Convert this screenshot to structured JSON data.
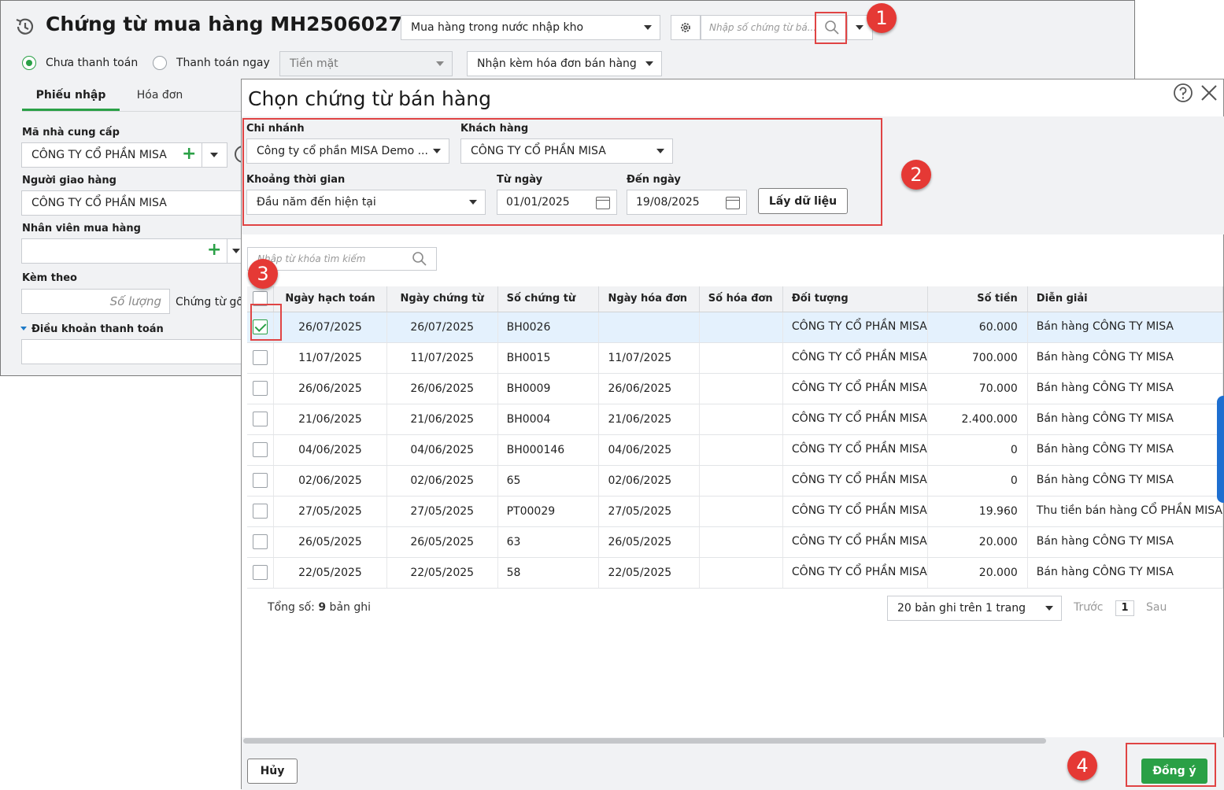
{
  "main_window": {
    "title": "Chứng từ mua hàng MH2506027",
    "purchase_type": "Mua hàng trong nước nhập kho",
    "search_placeholder": "Nhập số chứng từ bá...",
    "payment_unpaid_label": "Chưa thanh toán",
    "payment_now_label": "Thanh toán ngay",
    "payment_method": "Tiền mặt",
    "invoice_option": "Nhận kèm hóa đơn bán hàng",
    "tabs": [
      {
        "label": "Phiếu nhập"
      },
      {
        "label": "Hóa đơn"
      }
    ],
    "supplier_label": "Mã nhà cung cấp",
    "supplier_value": "CÔNG TY CỔ PHẦN MISA",
    "deliverer_label": "Người giao hàng",
    "deliverer_value": "CÔNG TY CỔ PHẦN MISA",
    "buyer_label": "Nhân viên mua hàng",
    "attach_label": "Kèm theo",
    "quantity_placeholder": "Số lượng",
    "original_docs_label": "Chứng từ gố",
    "payment_terms_label": "Điều khoản thanh toán"
  },
  "dialog": {
    "title": "Chọn chứng từ bán hàng",
    "branch_label": "Chi nhánh",
    "branch_value": "Công ty cổ phần MISA Demo ...",
    "customer_label": "Khách hàng",
    "customer_value": "CÔNG TY CỔ PHẦN MISA",
    "period_label": "Khoảng thời gian",
    "period_value": "Đầu năm đến hiện tại",
    "from_label": "Từ ngày",
    "from_value": "01/01/2025",
    "to_label": "Đến ngày",
    "to_value": "19/08/2025",
    "fetch_button": "Lấy dữ liệu",
    "keyword_placeholder": "Nhập từ khóa tìm kiếm",
    "columns": [
      "Ngày hạch toán",
      "Ngày chứng từ",
      "Số chứng từ",
      "Ngày hóa đơn",
      "Số hóa đơn",
      "Đối tượng",
      "Số tiền",
      "Diễn giải"
    ],
    "rows": [
      {
        "checked": true,
        "post_date": "26/07/2025",
        "doc_date": "26/07/2025",
        "doc_no": "BH0026",
        "inv_date": "",
        "inv_no": "",
        "object": "CÔNG TY CỔ PHẦN MISA",
        "amount": "60.000",
        "desc": "Bán hàng CÔNG TY MISA"
      },
      {
        "checked": false,
        "post_date": "11/07/2025",
        "doc_date": "11/07/2025",
        "doc_no": "BH0015",
        "inv_date": "11/07/2025",
        "inv_no": "",
        "object": "CÔNG TY CỔ PHẦN MISA",
        "amount": "700.000",
        "desc": "Bán hàng CÔNG TY MISA"
      },
      {
        "checked": false,
        "post_date": "26/06/2025",
        "doc_date": "26/06/2025",
        "doc_no": "BH0009",
        "inv_date": "26/06/2025",
        "inv_no": "",
        "object": "CÔNG TY CỔ PHẦN MISA",
        "amount": "70.000",
        "desc": "Bán hàng CÔNG TY MISA"
      },
      {
        "checked": false,
        "post_date": "21/06/2025",
        "doc_date": "21/06/2025",
        "doc_no": "BH0004",
        "inv_date": "21/06/2025",
        "inv_no": "",
        "object": "CÔNG TY CỔ PHẦN MISA",
        "amount": "2.400.000",
        "desc": "Bán hàng CÔNG TY MISA"
      },
      {
        "checked": false,
        "post_date": "04/06/2025",
        "doc_date": "04/06/2025",
        "doc_no": "BH000146",
        "inv_date": "04/06/2025",
        "inv_no": "",
        "object": "CÔNG TY CỔ PHẦN MISA",
        "amount": "0",
        "desc": "Bán hàng CÔNG TY MISA"
      },
      {
        "checked": false,
        "post_date": "02/06/2025",
        "doc_date": "02/06/2025",
        "doc_no": "65",
        "inv_date": "02/06/2025",
        "inv_no": "",
        "object": "CÔNG TY CỔ PHẦN MISA",
        "amount": "0",
        "desc": "Bán hàng CÔNG TY MISA"
      },
      {
        "checked": false,
        "post_date": "27/05/2025",
        "doc_date": "27/05/2025",
        "doc_no": "PT00029",
        "inv_date": "27/05/2025",
        "inv_no": "",
        "object": "CÔNG TY CỔ PHẦN MISA",
        "amount": "19.960",
        "desc": "Thu tiền bán hàng CỔ PHẦN MISA"
      },
      {
        "checked": false,
        "post_date": "26/05/2025",
        "doc_date": "26/05/2025",
        "doc_no": "63",
        "inv_date": "26/05/2025",
        "inv_no": "",
        "object": "CÔNG TY CỔ PHẦN MISA",
        "amount": "20.000",
        "desc": "Bán hàng CÔNG TY MISA"
      },
      {
        "checked": false,
        "post_date": "22/05/2025",
        "doc_date": "22/05/2025",
        "doc_no": "58",
        "inv_date": "22/05/2025",
        "inv_no": "",
        "object": "CÔNG TY CỔ PHẦN MISA",
        "amount": "20.000",
        "desc": "Bán hàng CÔNG TY MISA"
      }
    ],
    "total_prefix": "Tổng số: ",
    "total_count": "9",
    "total_suffix": " bản ghi",
    "page_size": "20 bản ghi trên 1 trang",
    "prev_label": "Trước",
    "page_number": "1",
    "next_label": "Sau",
    "cancel_button": "Hủy",
    "ok_button": "Đồng ý"
  },
  "annotations": [
    "1",
    "2",
    "3",
    "4"
  ],
  "colors": {
    "accent_green": "#2aa046",
    "link_blue": "#1e7ac7",
    "annotation_red": "#e53935"
  }
}
